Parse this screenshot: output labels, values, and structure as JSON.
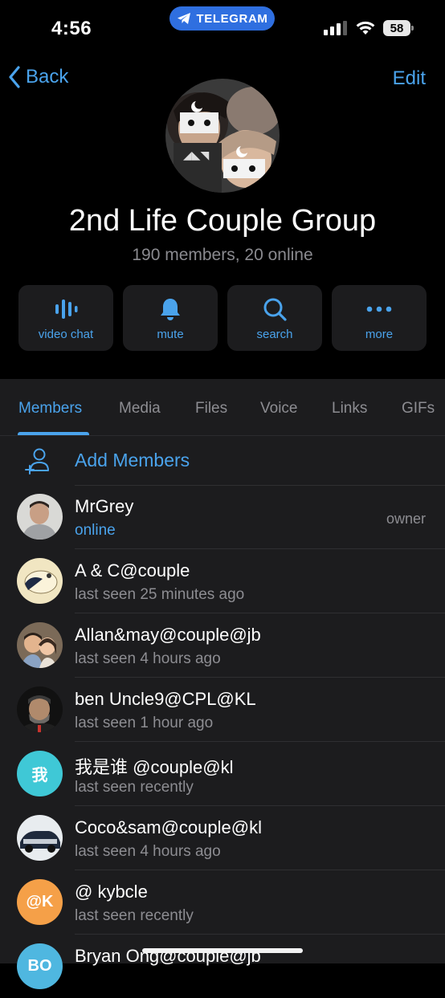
{
  "status_bar": {
    "time": "4:56",
    "app_pill": "TELEGRAM",
    "battery": "58"
  },
  "nav": {
    "back_label": "Back",
    "edit_label": "Edit"
  },
  "group": {
    "name": "2nd Life Couple Group",
    "subtitle": "190 members, 20 online"
  },
  "actions": [
    {
      "label": "video chat",
      "icon": "video-chat-icon"
    },
    {
      "label": "mute",
      "icon": "bell-icon"
    },
    {
      "label": "search",
      "icon": "search-icon"
    },
    {
      "label": "more",
      "icon": "more-icon"
    }
  ],
  "tabs": [
    "Members",
    "Media",
    "Files",
    "Voice",
    "Links",
    "GIFs"
  ],
  "active_tab": "Members",
  "add_members_label": "Add Members",
  "members": [
    {
      "name": "MrGrey",
      "status": "online",
      "role": "owner"
    },
    {
      "name": "A & C@couple",
      "status": "last seen 25 minutes ago"
    },
    {
      "name": "Allan&may@couple@jb",
      "status": "last seen 4 hours ago"
    },
    {
      "name": "ben Uncle9@CPL@KL",
      "status": "last seen 1 hour ago"
    },
    {
      "name": "我是谁 @couple@kl",
      "status": "last seen recently",
      "initials": "我"
    },
    {
      "name": "Coco&sam@couple@kl",
      "status": "last seen 4 hours ago"
    },
    {
      "name": "@ kybcle",
      "status": "last seen recently",
      "initials": "@K"
    },
    {
      "name": "Bryan Ong@couple@jb",
      "status": "",
      "initials": "BO"
    }
  ],
  "colors": {
    "accent": "#4aa3ec",
    "panel": "#1c1c1e",
    "background": "#000000",
    "teal_avatar": "#3fc8d6",
    "orange_avatar": "#f5a048"
  }
}
